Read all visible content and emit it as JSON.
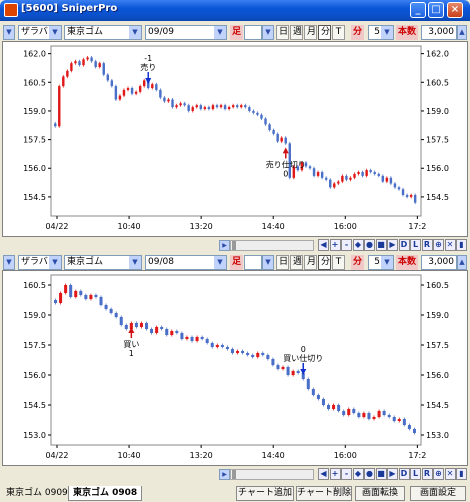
{
  "window": {
    "title": "[5600] SniperPro",
    "buttons": [
      "_",
      "□",
      "×"
    ]
  },
  "panels": [
    {
      "toolbar": {
        "market": "ザラバ",
        "commodity": "東京ゴム",
        "contract": "09/09",
        "label_ashi": "足",
        "btn_day": "日",
        "btn_week": "週",
        "btn_month": "月",
        "btn_min": "分",
        "btn_tick": "T",
        "label_min": "分",
        "interval": "5",
        "label_count": "本数",
        "count": "3,000"
      },
      "chart_data": {
        "type": "candlestick",
        "x_ticks": [
          "04/22",
          "10:40",
          "13:20",
          "14:40",
          "16:00",
          "17:2"
        ],
        "y_ticks": [
          "162.0",
          "160.5",
          "159.0",
          "157.5",
          "156.0",
          "154.5"
        ],
        "ylim": [
          153.5,
          162.4
        ],
        "closes": [
          158.2,
          160.3,
          160.8,
          161.1,
          161.5,
          161.6,
          161.4,
          161.7,
          161.8,
          161.6,
          161.3,
          161.5,
          160.9,
          160.6,
          160.3,
          159.6,
          159.8,
          160.1,
          160.2,
          159.9,
          160.0,
          160.3,
          160.6,
          160.2,
          160.4,
          160.1,
          159.7,
          159.5,
          159.6,
          159.2,
          159.3,
          159.4,
          159.3,
          159.0,
          159.2,
          159.3,
          159.1,
          159.2,
          159.1,
          159.3,
          159.2,
          159.3,
          159.1,
          159.2,
          159.3,
          159.2,
          159.3,
          159.2,
          159.0,
          158.9,
          158.8,
          158.6,
          158.3,
          158.0,
          157.8,
          157.4,
          157.6,
          157.3,
          155.5,
          156.1,
          155.9,
          156.3,
          156.1,
          156.0,
          155.6,
          155.8,
          155.5,
          155.4,
          155.0,
          155.2,
          155.3,
          155.6,
          155.4,
          155.5,
          155.7,
          155.8,
          155.6,
          155.9,
          155.8,
          155.7,
          155.6,
          155.3,
          155.5,
          155.2,
          155.0,
          154.9,
          154.6,
          154.5,
          154.6,
          154.2
        ],
        "annotations": [
          {
            "text": "-1",
            "label": "売り",
            "side": "sell",
            "index": 23
          },
          {
            "text": "売り仕切り",
            "sub": "0",
            "side": "buy",
            "index": 57
          }
        ]
      }
    },
    {
      "toolbar": {
        "market": "ザラバ",
        "commodity": "東京ゴム",
        "contract": "09/08",
        "label_ashi": "足",
        "btn_day": "日",
        "btn_week": "週",
        "btn_month": "月",
        "btn_min": "分",
        "btn_tick": "T",
        "label_min": "分",
        "interval": "5",
        "label_count": "本数",
        "count": "3,000"
      },
      "chart_data": {
        "type": "candlestick",
        "x_ticks": [
          "04/22",
          "10:40",
          "13:20",
          "14:40",
          "16:00",
          "17:2"
        ],
        "y_ticks": [
          "160.5",
          "159.0",
          "157.5",
          "156.0",
          "154.5",
          "153.0"
        ],
        "ylim": [
          152.5,
          161.0
        ],
        "closes": [
          159.6,
          160.1,
          160.5,
          159.9,
          160.2,
          160.0,
          159.8,
          160.0,
          159.9,
          159.5,
          159.3,
          159.1,
          158.9,
          158.5,
          158.3,
          158.6,
          158.4,
          158.6,
          158.3,
          158.1,
          158.4,
          158.3,
          158.0,
          158.2,
          158.1,
          157.8,
          157.9,
          157.7,
          157.9,
          157.8,
          157.6,
          157.4,
          157.5,
          157.4,
          157.3,
          157.1,
          157.2,
          157.1,
          157.0,
          156.9,
          157.1,
          157.0,
          156.8,
          156.5,
          156.3,
          156.4,
          156.0,
          156.2,
          156.1,
          155.8,
          155.3,
          155.0,
          154.8,
          154.5,
          154.3,
          154.5,
          154.2,
          154.0,
          154.3,
          154.1,
          153.9,
          154.1,
          153.8,
          153.9,
          154.2,
          154.0,
          153.9,
          153.7,
          153.8,
          153.5,
          153.3,
          153.1
        ],
        "annotations": [
          {
            "text": "買い",
            "sub": "1",
            "side": "buy",
            "index": 15
          },
          {
            "text": "0",
            "label": "買い仕切り",
            "side": "sell",
            "index": 49
          }
        ]
      }
    }
  ],
  "nav_buttons": [
    "◀",
    "+",
    "-",
    "◆",
    "●",
    "■",
    "▶",
    "D",
    "L",
    "R",
    "⊕",
    "✕",
    "▮"
  ],
  "footer": {
    "tabs": [
      "東京ゴム 0909",
      "東京ゴム 0908"
    ],
    "buttons": [
      "チャート追加",
      "チャート削除",
      "画面転換",
      "画面設定"
    ]
  },
  "colors": {
    "up": "#e01818",
    "down": "#4a6fc8",
    "title_blue": "#0a56d8"
  }
}
